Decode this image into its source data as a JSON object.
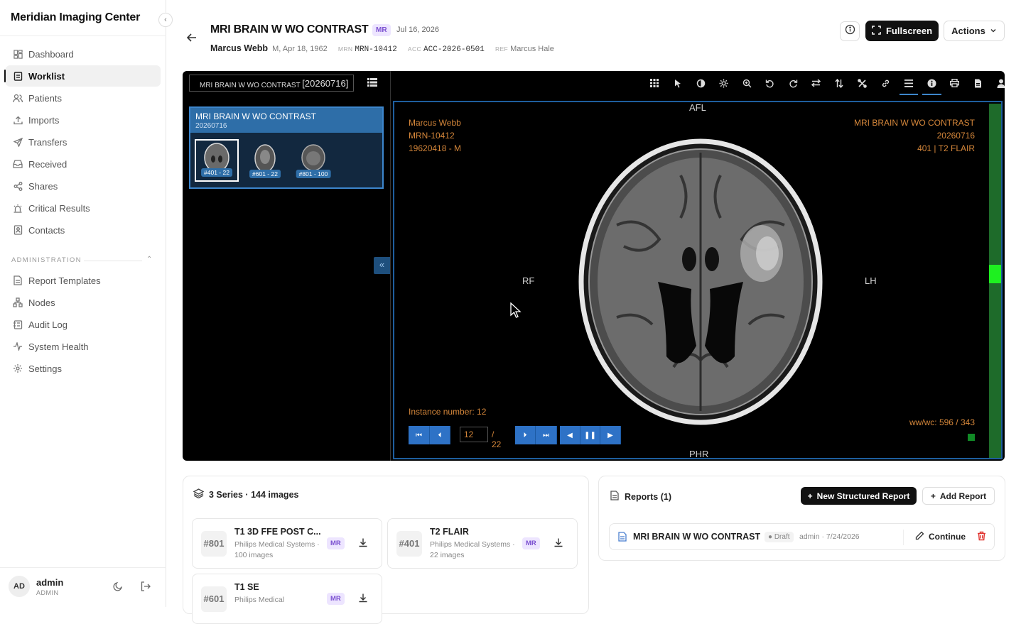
{
  "app": {
    "name": "Meridian Imaging Center"
  },
  "nav": {
    "items": [
      {
        "label": "Dashboard"
      },
      {
        "label": "Worklist"
      },
      {
        "label": "Patients"
      },
      {
        "label": "Imports"
      },
      {
        "label": "Transfers"
      },
      {
        "label": "Received"
      },
      {
        "label": "Shares"
      },
      {
        "label": "Critical Results"
      },
      {
        "label": "Contacts"
      }
    ],
    "admin_heading": "ADMINISTRATION",
    "admin_items": [
      {
        "label": "Report Templates"
      },
      {
        "label": "Nodes"
      },
      {
        "label": "Audit Log"
      },
      {
        "label": "System Health"
      },
      {
        "label": "Settings"
      }
    ],
    "active": "Worklist"
  },
  "user": {
    "initials": "AD",
    "name": "admin",
    "role": "ADMIN"
  },
  "study": {
    "title": "MRI BRAIN W WO CONTRAST",
    "modality": "MR",
    "date": "Jul 16, 2026",
    "patient_name": "Marcus Webb",
    "patient_info": "M, Apr 18, 1962",
    "mrn_label": "MRN",
    "mrn": "MRN-10412",
    "acc_label": "ACC",
    "acc": "ACC-2026-0501",
    "ref_label": "REF",
    "ref": "Marcus Hale"
  },
  "header_actions": {
    "fullscreen": "Fullscreen",
    "actions": "Actions"
  },
  "viewer": {
    "study_selector": "MRI BRAIN W WO CONTRAST",
    "study_selector_date": "[20260716]",
    "card_title": "MRI BRAIN W WO CONTRAST",
    "card_date": "20260716",
    "thumbnails": [
      {
        "label": "#401 - 22"
      },
      {
        "label": "#601 - 22"
      },
      {
        "label": "#801 - 100"
      }
    ],
    "toolbar_icons": [
      "layout-grid-icon",
      "pointer-icon",
      "contrast-icon",
      "brightness-icon",
      "zoom-icon",
      "rotate-left-icon",
      "rotate-right-icon",
      "flip-horizontal-icon",
      "flip-vertical-icon",
      "crosshair-icon",
      "link-icon",
      "menu-icon",
      "info-icon",
      "print-icon",
      "file-icon",
      "user-icon"
    ],
    "overlay": {
      "top_left": [
        "Marcus Webb",
        "MRN-10412",
        "19620418 - M"
      ],
      "top_right": [
        "MRI BRAIN W WO CONTRAST",
        "20260716",
        "401 | T2 FLAIR"
      ],
      "instance": "Instance number: 12",
      "wwwc": "ww/wc: 596 / 343"
    },
    "orientation": {
      "top": "AFL",
      "bottom": "PHR",
      "left": "RF",
      "right": "LH"
    },
    "frame": {
      "current": "12",
      "total": "/ 22"
    },
    "scroll_position": 0.48,
    "accent_color": "#2e72c6",
    "overlay_color": "#d4863a"
  },
  "series": {
    "heading": "3 Series · 144 images",
    "items": [
      {
        "number": "#801",
        "name": "T1 3D FFE POST C...",
        "desc": "Philips Medical Systems · 100 images",
        "modality": "MR"
      },
      {
        "number": "#401",
        "name": "T2 FLAIR",
        "desc": "Philips Medical Systems · 22 images",
        "modality": "MR"
      },
      {
        "number": "#601",
        "name": "T1 SE",
        "desc": "Philips Medical",
        "modality": "MR"
      }
    ]
  },
  "reports": {
    "heading": "Reports (1)",
    "new_structured": "New Structured Report",
    "add": "Add Report",
    "items": [
      {
        "title": "MRI BRAIN W WO CONTRAST",
        "status": "Draft",
        "meta": "admin · 7/24/2026",
        "action": "Continue"
      }
    ]
  }
}
